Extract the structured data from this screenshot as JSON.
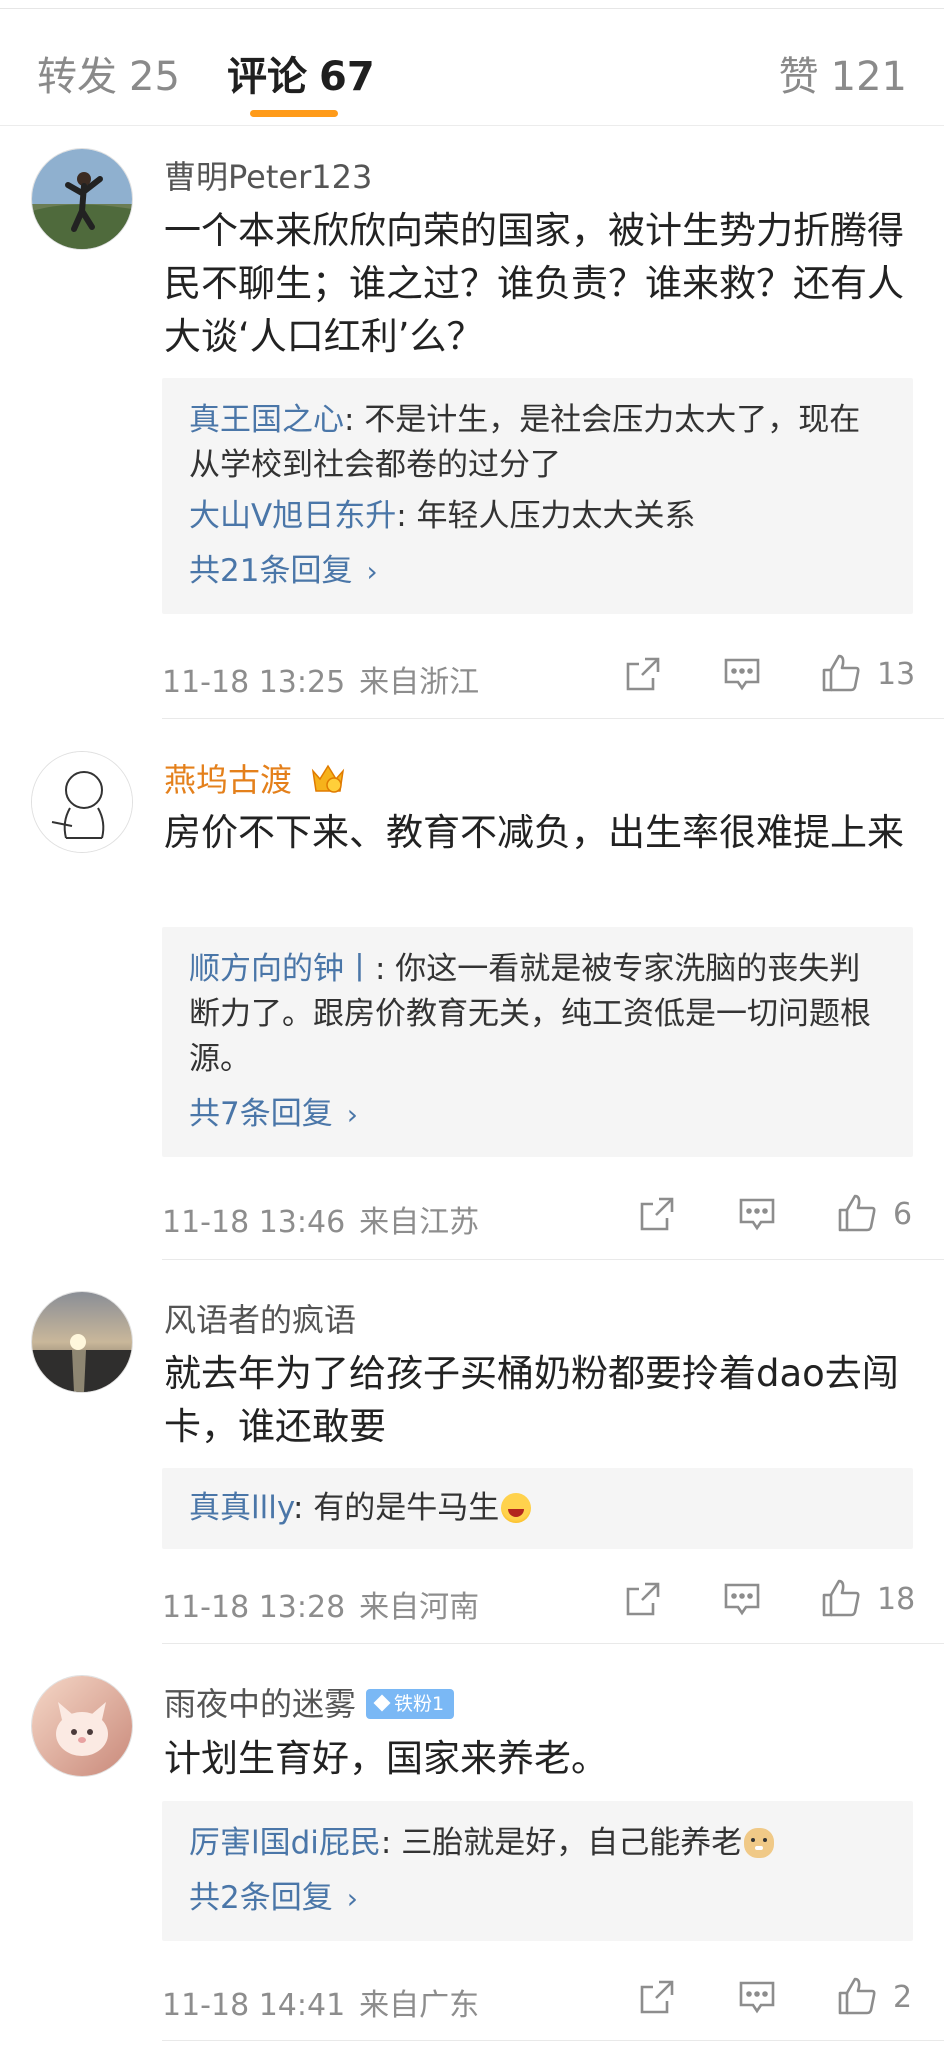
{
  "tabs": {
    "repost": {
      "label": "转发",
      "count": "25"
    },
    "comments": {
      "label": "评论",
      "count": "67"
    },
    "likes": {
      "label": "赞",
      "count": "121"
    }
  },
  "comments": [
    {
      "username": "曹明Peter123",
      "text": "一个本来欣欣向荣的国家，被计生势力折腾得民不聊生；谁之过？谁负责？谁来救？还有人大谈‘人口红利’么？",
      "replies": [
        {
          "user": "真王国之心",
          "text": ": 不是计生，是社会压力太大了，现在从学校到社会都卷的过分了"
        },
        {
          "user": "大山V旭日东升",
          "text": ": 年轻人压力太大关系"
        }
      ],
      "more_replies": "共21条回复",
      "time": "11-18 13:25",
      "location": "来自浙江",
      "like_count": "13"
    },
    {
      "username": "燕坞古渡",
      "text": "房价不下来、教育不减负，出生率很难提上来",
      "replies": [
        {
          "user": "顺方向的钟丨",
          "text": ": 你这一看就是被专家洗脑的丧失判断力了。跟房价教育无关，纯工资低是一切问题根源。"
        }
      ],
      "more_replies": "共7条回复",
      "time": "11-18 13:46",
      "location": "来自江苏",
      "like_count": "6"
    },
    {
      "username": "风语者的疯语",
      "text": "就去年为了给孩子买桶奶粉都要拎着dao去闯卡，谁还敢要",
      "replies": [
        {
          "user": "真真llly",
          "text": ": 有的是牛马生"
        }
      ],
      "time": "11-18 13:28",
      "location": "来自河南",
      "like_count": "18"
    },
    {
      "username": "雨夜中的迷雾",
      "badge": "铁粉1",
      "text": "计划生育好，国家来养老。",
      "replies": [
        {
          "user": "厉害l国di屁民",
          "text": ": 三胎就是好，自己能养老"
        }
      ],
      "more_replies": "共2条回复",
      "time": "11-18 14:41",
      "location": "来自广东",
      "like_count": "2"
    }
  ],
  "icons": {
    "share": "share-icon",
    "comment": "comment-icon",
    "like": "thumbs-up-icon",
    "accent": "#ff9b1a",
    "link_color": "#4a76a8"
  }
}
